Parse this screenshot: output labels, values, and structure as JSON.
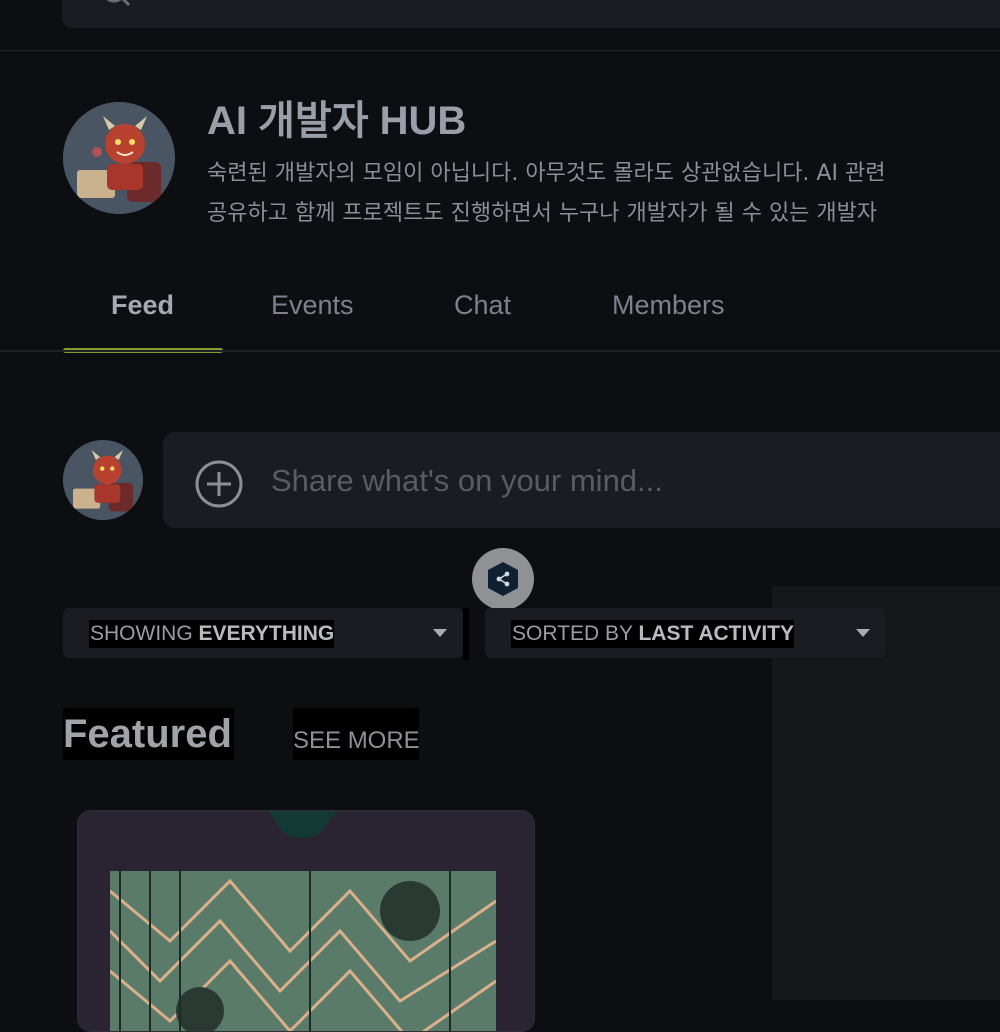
{
  "group": {
    "title": "AI 개발자 HUB",
    "description_line1": "숙련된 개발자의 모임이 아닙니다. 아무것도 몰라도 상관없습니다. AI 관련",
    "description_line2": "공유하고 함께 프로젝트도 진행하면서 누구나 개발자가 될 수 있는 개발자"
  },
  "tabs": [
    {
      "label": "Feed",
      "active": true
    },
    {
      "label": "Events",
      "active": false
    },
    {
      "label": "Chat",
      "active": false
    },
    {
      "label": "Members",
      "active": false
    }
  ],
  "composer": {
    "placeholder": "Share what's on your mind..."
  },
  "filters": {
    "show_prefix": "SHOWING",
    "show_value": "EVERYTHING",
    "sort_prefix": "SORTED BY",
    "sort_value": "LAST ACTIVITY"
  },
  "featured": {
    "title": "Featured",
    "see_more": "SEE MORE"
  },
  "colors": {
    "accent_underline": "#8b9a2e",
    "background": "#0d0e12",
    "surface": "#1b1c21"
  },
  "icons": [
    "search-icon",
    "plus-circle-icon",
    "chevron-down-icon",
    "translate-badge-icon"
  ]
}
